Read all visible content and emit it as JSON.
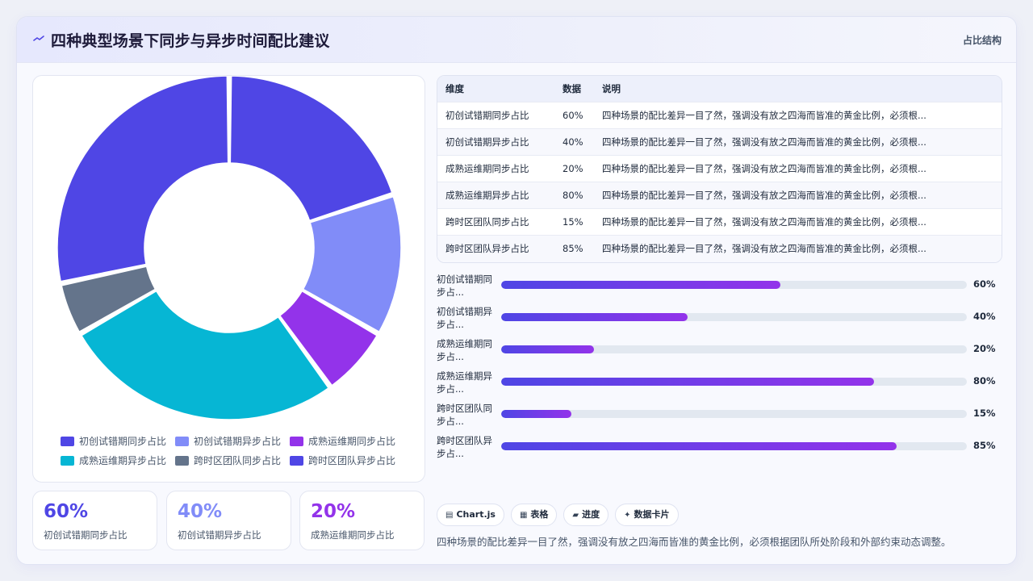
{
  "header": {
    "icon": "trend-icon",
    "title": "四种典型场景下同步与异步时间配比建议",
    "tag": "占比结构"
  },
  "chart_data": {
    "type": "pie",
    "categories": [
      "初创试错期同步占比",
      "初创试错期异步占比",
      "成熟运维期同步占比",
      "成熟运维期异步占比",
      "跨时区团队同步占比",
      "跨时区团队异步占比"
    ],
    "values": [
      60,
      40,
      20,
      80,
      15,
      85
    ],
    "colors": [
      "#4f46e5",
      "#818cf8",
      "#9333ea",
      "#06b6d4",
      "#64748b",
      "#4f46e5"
    ],
    "legend_position": "bottom"
  },
  "stats": [
    {
      "value": "60%",
      "label": "初创试错期同步占比",
      "color": "#4f46e5"
    },
    {
      "value": "40%",
      "label": "初创试错期异步占比",
      "color": "#818cf8"
    },
    {
      "value": "20%",
      "label": "成熟运维期同步占比",
      "color": "#9333ea"
    }
  ],
  "table": {
    "headers": [
      "维度",
      "数据",
      "说明"
    ],
    "rows": [
      [
        "初创试错期同步占比",
        "60%",
        "四种场景的配比差异一目了然，强调没有放之四海而皆准的黄金比例，必须根..."
      ],
      [
        "初创试错期异步占比",
        "40%",
        "四种场景的配比差异一目了然，强调没有放之四海而皆准的黄金比例，必须根..."
      ],
      [
        "成熟运维期同步占比",
        "20%",
        "四种场景的配比差异一目了然，强调没有放之四海而皆准的黄金比例，必须根..."
      ],
      [
        "成熟运维期异步占比",
        "80%",
        "四种场景的配比差异一目了然，强调没有放之四海而皆准的黄金比例，必须根..."
      ],
      [
        "跨时区团队同步占比",
        "15%",
        "四种场景的配比差异一目了然，强调没有放之四海而皆准的黄金比例，必须根..."
      ],
      [
        "跨时区团队异步占比",
        "85%",
        "四种场景的配比差异一目了然，强调没有放之四海而皆准的黄金比例，必须根..."
      ]
    ]
  },
  "progress": [
    {
      "label": "初创试错期同步占...",
      "value": 60,
      "display": "60%"
    },
    {
      "label": "初创试错期异步占...",
      "value": 40,
      "display": "40%"
    },
    {
      "label": "成熟运维期同步占...",
      "value": 20,
      "display": "20%"
    },
    {
      "label": "成熟运维期异步占...",
      "value": 80,
      "display": "80%"
    },
    {
      "label": "跨时区团队同步占...",
      "value": 15,
      "display": "15%"
    },
    {
      "label": "跨时区团队异步占...",
      "value": 85,
      "display": "85%"
    }
  ],
  "chips": [
    {
      "icon": "▤",
      "label": "Chart.js"
    },
    {
      "icon": "▦",
      "label": "表格"
    },
    {
      "icon": "▰",
      "label": "进度"
    },
    {
      "icon": "✦",
      "label": "数据卡片"
    }
  ],
  "note": "四种场景的配比差异一目了然，强调没有放之四海而皆准的黄金比例，必须根据团队所处阶段和外部约束动态调整。"
}
